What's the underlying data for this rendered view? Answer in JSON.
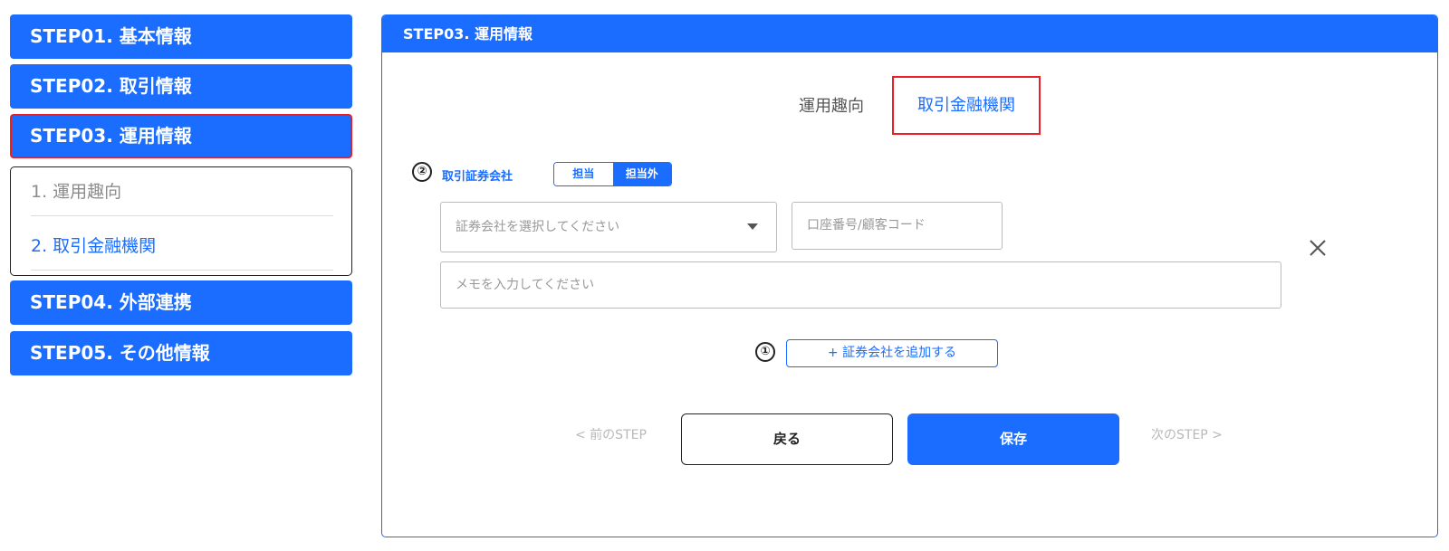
{
  "sidebar": {
    "steps": [
      {
        "label": "STEP01. 基本情報"
      },
      {
        "label": "STEP02. 取引情報"
      },
      {
        "label": "STEP03. 運用情報"
      },
      {
        "label": "STEP04. 外部連携"
      },
      {
        "label": "STEP05. その他情報"
      }
    ],
    "substeps": [
      {
        "label": "1. 運用趣向"
      },
      {
        "label": "2. 取引金融機関"
      }
    ]
  },
  "panel": {
    "title": "STEP03. 運用情報",
    "tabs": [
      {
        "label": "運用趣向"
      },
      {
        "label": "取引金融機関"
      }
    ],
    "markers": {
      "one": "①",
      "two": "②"
    },
    "field_label": "取引証券会社",
    "toggle": {
      "off": "担当",
      "on": "担当外"
    },
    "select_placeholder": "証券会社を選択してください",
    "account_placeholder": "口座番号/顧客コード",
    "memo_placeholder": "メモを入力してください",
    "add_label": "+ 証券会社を追加する",
    "prev_label": "< 前のSTEP",
    "back_label": "戻る",
    "save_label": "保存",
    "next_label": "次のSTEP >"
  },
  "colors": {
    "accent": "#1a6dff",
    "highlight": "#e8202a"
  }
}
